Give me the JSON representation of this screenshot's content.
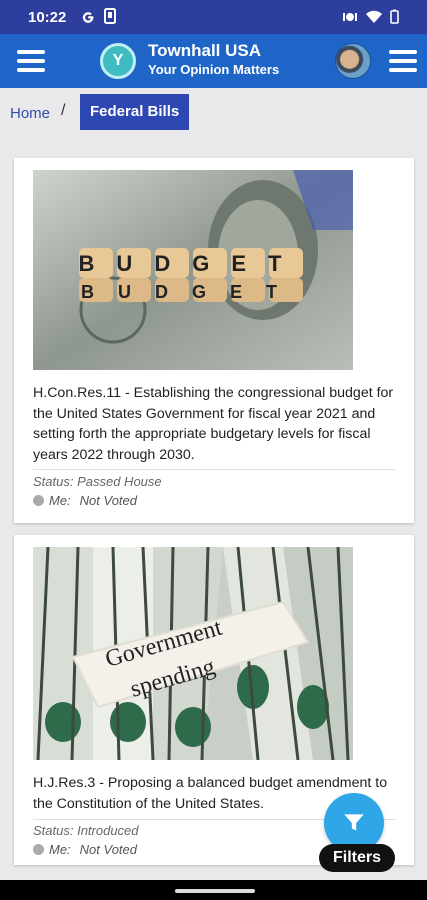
{
  "status_bar": {
    "time": "10:22"
  },
  "app_bar": {
    "logo_letter": "Y",
    "title": "Townhall USA",
    "subtitle": "Your Opinion Matters"
  },
  "breadcrumb": {
    "home": "Home",
    "separator": "/",
    "current": "Federal Bills"
  },
  "bills": [
    {
      "image_caption_1": "BUDGET",
      "image_caption_2": "BUDGET",
      "title": "H.Con.Res.11 - Establishing the congressional budget for the United States Government for fiscal year 2021 and setting forth the appropriate budgetary levels for fiscal years 2022 through 2030.",
      "status": "Status: Passed House",
      "me_label": "Me:",
      "me_value": "Not Voted"
    },
    {
      "image_caption_1": "Government",
      "image_caption_2": "spending",
      "title": "H.J.Res.3 - Proposing a balanced budget amendment to the Constitution of the United States.",
      "status": "Status: Introduced",
      "me_label": "Me:",
      "me_value": "Not Voted"
    }
  ],
  "filters_label": "Filters",
  "colors": {
    "status_bar": "#2e3e9c",
    "app_bar": "#1f65c8",
    "breadcrumb_active": "#2e48b3",
    "fab": "#2fa6e8"
  }
}
